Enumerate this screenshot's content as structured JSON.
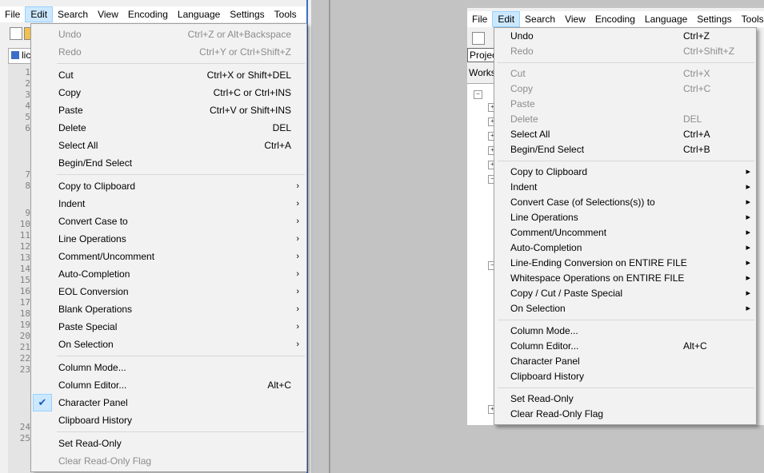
{
  "left": {
    "menubar": [
      "File",
      "Edit",
      "Search",
      "View",
      "Encoding",
      "Language",
      "Settings",
      "Tools"
    ],
    "tab_label": "lic",
    "line_numbers": [
      "1",
      "2",
      "3",
      "4",
      "5",
      "6",
      "7",
      "8",
      "9",
      "10",
      "11",
      "12",
      "13",
      "14",
      "15",
      "16",
      "17",
      "18",
      "19",
      "20",
      "21",
      "22",
      "23",
      "24",
      "25"
    ],
    "menu": [
      {
        "label": "Undo",
        "shortcut": "Ctrl+Z or Alt+Backspace",
        "disabled": true
      },
      {
        "label": "Redo",
        "shortcut": "Ctrl+Y or Ctrl+Shift+Z",
        "disabled": true
      },
      {
        "sep": true
      },
      {
        "label": "Cut",
        "shortcut": "Ctrl+X or Shift+DEL"
      },
      {
        "label": "Copy",
        "shortcut": "Ctrl+C or Ctrl+INS"
      },
      {
        "label": "Paste",
        "shortcut": "Ctrl+V or Shift+INS"
      },
      {
        "label": "Delete",
        "shortcut": "DEL"
      },
      {
        "label": "Select All",
        "shortcut": "Ctrl+A"
      },
      {
        "label": "Begin/End Select",
        "shortcut": ""
      },
      {
        "sep": true
      },
      {
        "label": "Copy to Clipboard",
        "submenu": true
      },
      {
        "label": "Indent",
        "submenu": true
      },
      {
        "label": "Convert Case to",
        "submenu": true
      },
      {
        "label": "Line Operations",
        "submenu": true
      },
      {
        "label": "Comment/Uncomment",
        "submenu": true
      },
      {
        "label": "Auto-Completion",
        "submenu": true
      },
      {
        "label": "EOL Conversion",
        "submenu": true
      },
      {
        "label": "Blank Operations",
        "submenu": true
      },
      {
        "label": "Paste Special",
        "submenu": true
      },
      {
        "label": "On Selection",
        "submenu": true
      },
      {
        "sep": true
      },
      {
        "label": "Column Mode...",
        "shortcut": ""
      },
      {
        "label": "Column Editor...",
        "shortcut": "Alt+C"
      },
      {
        "label": "Character Panel",
        "shortcut": "",
        "checked": true
      },
      {
        "label": "Clipboard History",
        "shortcut": ""
      },
      {
        "sep": true
      },
      {
        "label": "Set Read-Only",
        "shortcut": ""
      },
      {
        "label": "Clear Read-Only Flag",
        "shortcut": "",
        "disabled": true
      }
    ]
  },
  "right": {
    "menubar": [
      "File",
      "Edit",
      "Search",
      "View",
      "Encoding",
      "Language",
      "Settings",
      "Tools"
    ],
    "project_label": "Projec",
    "workspace_label": "Works",
    "menu": [
      {
        "label": "Undo",
        "shortcut": "Ctrl+Z"
      },
      {
        "label": "Redo",
        "shortcut": "Ctrl+Shift+Z",
        "disabled": true
      },
      {
        "sep": true
      },
      {
        "label": "Cut",
        "shortcut": "Ctrl+X",
        "disabled": true
      },
      {
        "label": "Copy",
        "shortcut": "Ctrl+C",
        "disabled": true
      },
      {
        "label": "Paste",
        "shortcut": "",
        "disabled": true
      },
      {
        "label": "Delete",
        "shortcut": "DEL",
        "disabled": true
      },
      {
        "label": "Select All",
        "shortcut": "Ctrl+A"
      },
      {
        "label": "Begin/End Select",
        "shortcut": "Ctrl+B"
      },
      {
        "sep": true
      },
      {
        "label": "Copy to Clipboard",
        "submenu": true
      },
      {
        "label": "Indent",
        "submenu": true
      },
      {
        "label": "Convert Case (of Selections(s)) to",
        "submenu": true
      },
      {
        "label": "Line Operations",
        "submenu": true
      },
      {
        "label": "Comment/Uncomment",
        "submenu": true
      },
      {
        "label": "Auto-Completion",
        "submenu": true
      },
      {
        "label": "Line-Ending Conversion on ENTIRE FILE",
        "submenu": true
      },
      {
        "label": "Whitespace Operations on ENTIRE FILE",
        "submenu": true
      },
      {
        "label": "Copy / Cut / Paste Special",
        "submenu": true
      },
      {
        "label": "On Selection",
        "submenu": true
      },
      {
        "sep": true
      },
      {
        "label": "Column Mode...",
        "shortcut": ""
      },
      {
        "label": "Column Editor...",
        "shortcut": "Alt+C"
      },
      {
        "label": "Character Panel",
        "shortcut": ""
      },
      {
        "label": "Clipboard History",
        "shortcut": ""
      },
      {
        "sep": true
      },
      {
        "label": "Set Read-Only",
        "shortcut": ""
      },
      {
        "label": "Clear Read-Only Flag",
        "shortcut": ""
      }
    ]
  }
}
